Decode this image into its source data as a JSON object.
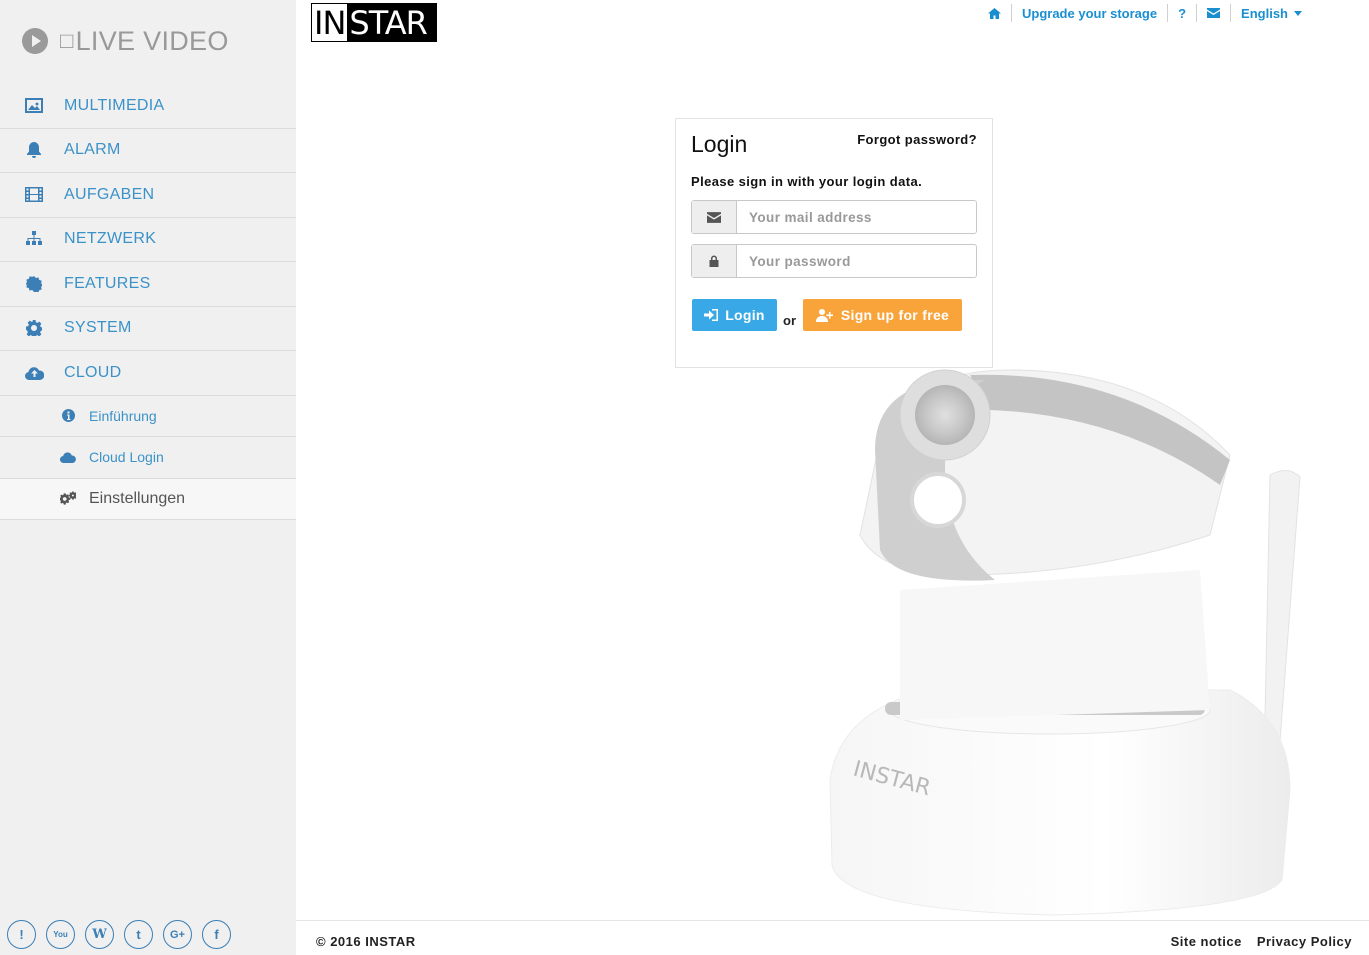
{
  "sidebar": {
    "live_video": {
      "box_glyph": "□",
      "label": "LIVE VIDEO",
      "icon": "play-circle-icon"
    },
    "items": [
      {
        "label": "MULTIMEDIA",
        "icon": "image-icon"
      },
      {
        "label": "ALARM",
        "icon": "bell-icon"
      },
      {
        "label": "AUFGABEN",
        "icon": "film-icon"
      },
      {
        "label": "NETZWERK",
        "icon": "sitemap-icon"
      },
      {
        "label": "FEATURES",
        "icon": "certificate-icon"
      },
      {
        "label": "SYSTEM",
        "icon": "gear-icon"
      },
      {
        "label": "CLOUD",
        "icon": "cloud-upload-icon"
      }
    ],
    "subitems": [
      {
        "label": "Einführung",
        "icon": "info-circle-icon"
      },
      {
        "label": "Cloud Login",
        "icon": "cloud-icon"
      },
      {
        "label": "Einstellungen",
        "icon": "gears-icon",
        "active": true
      }
    ],
    "social": [
      {
        "glyph": "!",
        "icon": "warning-icon"
      },
      {
        "glyph": "You",
        "icon": "youtube-icon"
      },
      {
        "glyph": "W",
        "icon": "wikipedia-icon"
      },
      {
        "glyph": "t",
        "icon": "twitter-icon"
      },
      {
        "glyph": "G+",
        "icon": "google-plus-icon"
      },
      {
        "glyph": "f",
        "icon": "facebook-icon"
      }
    ]
  },
  "header": {
    "logo_in": "IN",
    "logo_star": "STAR",
    "nav": {
      "home_icon": "home-icon",
      "upgrade": "Upgrade your storage",
      "help": "?",
      "mail_icon": "envelope-icon",
      "language": "English"
    }
  },
  "login": {
    "title": "Login",
    "forgot": "Forgot password?",
    "hint": "Please sign in with your login data.",
    "email_placeholder": "Your mail address",
    "password_placeholder": "Your password",
    "login_button": "Login",
    "or": "or",
    "signup_button": "Sign up for free"
  },
  "camera_brand": "INSTAR",
  "footer": {
    "copyright": "© 2016 INSTAR",
    "site_notice": "Site notice",
    "privacy": "Privacy Policy"
  },
  "colors": {
    "accent": "#1a8fd0",
    "sidebar_text": "#3b92c9",
    "login_button": "#38a8e6",
    "signup_button": "#f8a43b"
  }
}
